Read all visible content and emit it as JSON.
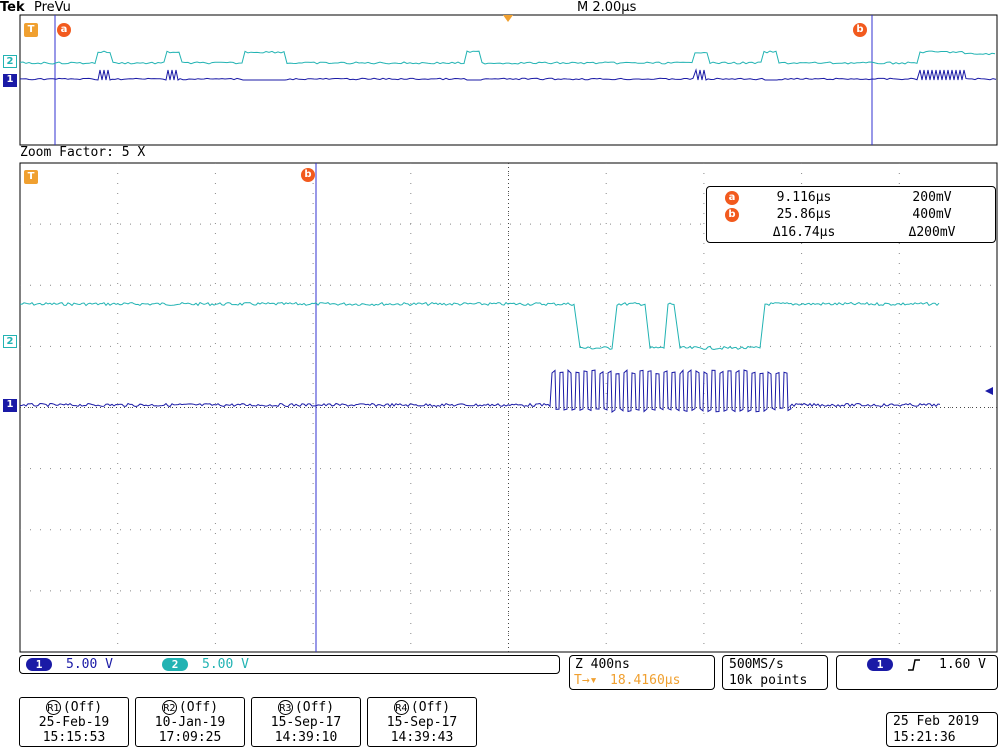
{
  "header": {
    "brand": "Tek",
    "acq_state": "PreVu",
    "timebase": "M 2.00µs"
  },
  "zoom": {
    "label": "Zoom Factor: 5 X"
  },
  "cursors": {
    "a": {
      "glyph": "a",
      "time": "9.116µs",
      "volt": "200mV"
    },
    "b": {
      "glyph": "b",
      "time": "25.86µs",
      "volt": "400mV"
    },
    "delta": {
      "time": "Δ16.74µs",
      "volt": "Δ200mV"
    }
  },
  "trigger_marker": "T",
  "channel_markers": {
    "ch1": "1",
    "ch2": "2"
  },
  "channels": {
    "ch1": {
      "number": "1",
      "scale": "5.00 V",
      "color": "#1a1aa6"
    },
    "ch2": {
      "number": "2",
      "scale": "5.00 V",
      "color": "#22b3b3"
    }
  },
  "horizontal": {
    "zoom_scale": "Z 400ns",
    "trigger_pos": "18.4160µs",
    "trigger_glyph": "T→▾"
  },
  "acquisition": {
    "sample_rate": "500MS/s",
    "record_length": "10k points"
  },
  "trigger": {
    "source": "1",
    "slope_icon": "rising-edge",
    "level": "1.60 V"
  },
  "references": [
    {
      "id": "R1",
      "state": "(Off)",
      "date": "25-Feb-19",
      "time": "15:15:53"
    },
    {
      "id": "R2",
      "state": "(Off)",
      "date": "10-Jan-19",
      "time": "17:09:25"
    },
    {
      "id": "R3",
      "state": "(Off)",
      "date": "15-Sep-17",
      "time": "14:39:10"
    },
    {
      "id": "R4",
      "state": "(Off)",
      "date": "15-Sep-17",
      "time": "14:39:43"
    }
  ],
  "datetime": {
    "date": "25 Feb  2019",
    "time": "15:21:36"
  },
  "colors": {
    "ch1": "#1a1aa6",
    "ch2": "#22b3b3",
    "cursor_marker": "#f25a1e",
    "trigger": "#f0a030"
  }
}
